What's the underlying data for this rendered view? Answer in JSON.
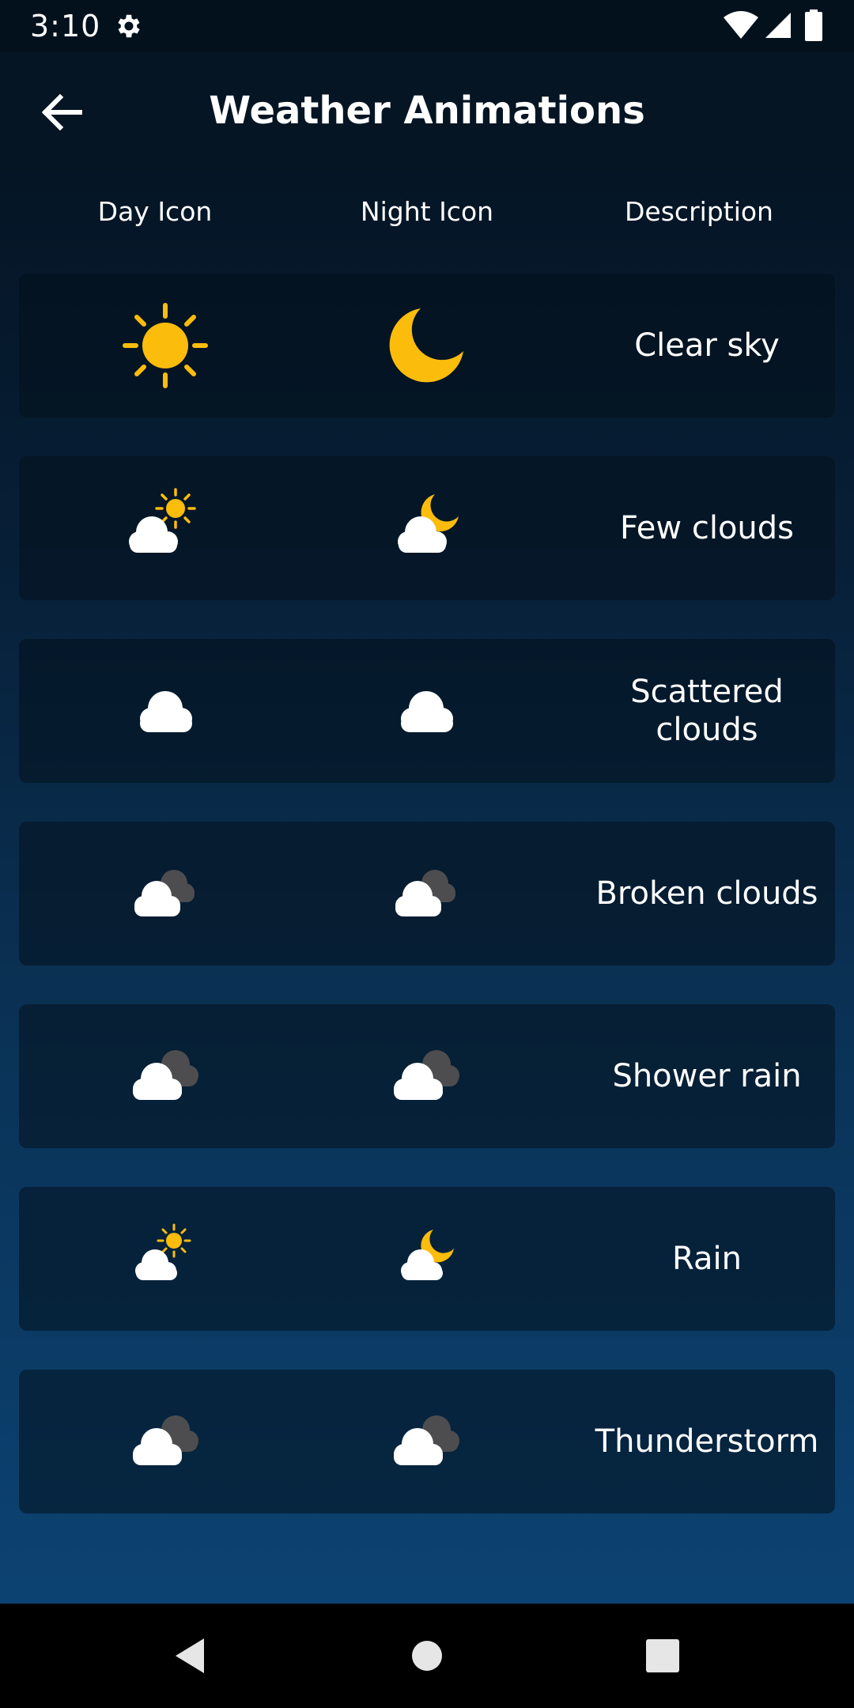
{
  "status_bar": {
    "time": "3:10",
    "icons": [
      "gear-icon",
      "wifi-icon",
      "signal-icon",
      "battery-icon"
    ]
  },
  "toolbar": {
    "title": "Weather Animations",
    "back_icon": "arrow-left-icon"
  },
  "table": {
    "headers": {
      "day": "Day Icon",
      "night": "Night Icon",
      "description": "Description"
    },
    "rows": [
      {
        "description": "Clear sky",
        "day_icon": "sun-icon",
        "night_icon": "moon-icon"
      },
      {
        "description": "Few clouds",
        "day_icon": "sun-cloud-icon",
        "night_icon": "moon-cloud-icon"
      },
      {
        "description": "Scattered clouds",
        "day_icon": "cloud-icon",
        "night_icon": "cloud-icon"
      },
      {
        "description": "Broken clouds",
        "day_icon": "broken-clouds-icon",
        "night_icon": "broken-clouds-icon"
      },
      {
        "description": "Shower rain",
        "day_icon": "broken-clouds-icon",
        "night_icon": "broken-clouds-icon"
      },
      {
        "description": "Rain",
        "day_icon": "sun-cloud-icon",
        "night_icon": "moon-cloud-icon"
      },
      {
        "description": "Thunderstorm",
        "day_icon": "broken-clouds-icon",
        "night_icon": "broken-clouds-icon"
      }
    ]
  },
  "nav_bar": {
    "icons": [
      "nav-back-icon",
      "nav-home-icon",
      "nav-recents-icon"
    ]
  },
  "colors": {
    "sun": "#fbbc0c",
    "cloud": "#ffffff",
    "dark_cloud": "#4d4d4f",
    "text": "#ffffff"
  }
}
